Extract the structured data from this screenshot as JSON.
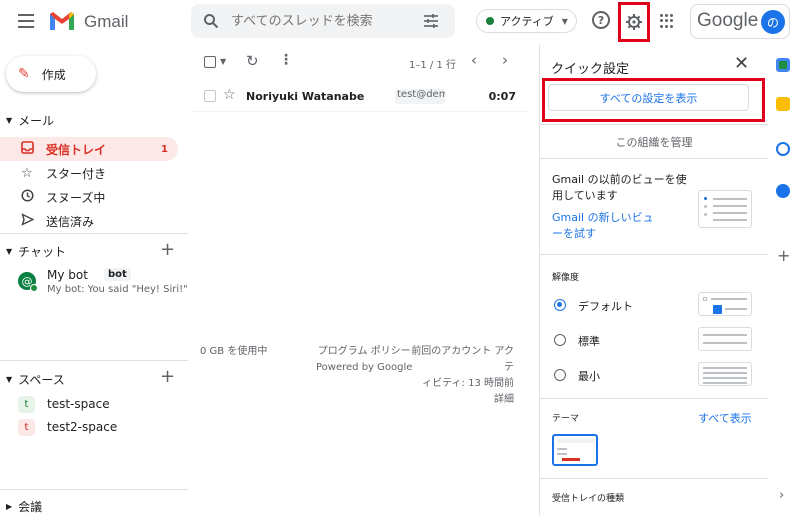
{
  "header": {
    "app_name": "Gmail",
    "search_placeholder": "すべてのスレッドを検索",
    "status_label": "アクティブ",
    "help_glyph": "?",
    "account_brand": "Google",
    "avatar_initial": "の"
  },
  "sidebar": {
    "compose_label": "作成",
    "mail_section": "メール",
    "nav": [
      {
        "label": "受信トレイ",
        "count": "1",
        "icon": "inbox-icon"
      },
      {
        "label": "スター付き",
        "icon": "star-icon"
      },
      {
        "label": "スヌーズ中",
        "icon": "clock-icon"
      },
      {
        "label": "送信済み",
        "icon": "send-icon"
      }
    ],
    "chat_section": "チャット",
    "chat": {
      "name": "My bot",
      "badge": "bot",
      "message": "My bot: You said \"Hey! Siri!\""
    },
    "spaces_section": "スペース",
    "spaces": [
      {
        "initial": "t",
        "name": "test-space",
        "bg": "#e6f4ea",
        "fg": "#188038"
      },
      {
        "initial": "t",
        "name": "test2-space",
        "bg": "#fce8e6",
        "fg": "#c5221f"
      }
    ],
    "meet_section": "会議"
  },
  "mail_list": {
    "range": "1–1 / 1 行",
    "rows": [
      {
        "sender": "Noriyuki Watanabe",
        "tag": "test@demo",
        "time": "0:07"
      }
    ],
    "footer": {
      "storage": "0 GB を使用中",
      "policy_1": "プログラム ポリシー",
      "policy_2": "Powered by Google",
      "activity_1": "前回のアカウント アクテ",
      "activity_2": "ィビティ: 13 時間前",
      "details": "詳細"
    }
  },
  "quick_settings": {
    "title": "クイック設定",
    "all_settings": "すべての設定を表示",
    "manage_org": "この組織を管理",
    "prev_view_text": "Gmail の以前のビューを使用しています",
    "try_new": "Gmail の新しいビューを試す",
    "density_title": "解像度",
    "density_options": [
      {
        "label": "デフォルト",
        "selected": true
      },
      {
        "label": "標準",
        "selected": false
      },
      {
        "label": "最小",
        "selected": false
      }
    ],
    "theme_title": "テーマ",
    "theme_show_all": "すべて表示",
    "inbox_type_title": "受信トレイの種類"
  },
  "colors": {
    "accent": "#1a73e8",
    "highlight": "#e0001b",
    "active_nav_bg": "#fce8e6",
    "active_nav_fg": "#d93025"
  }
}
